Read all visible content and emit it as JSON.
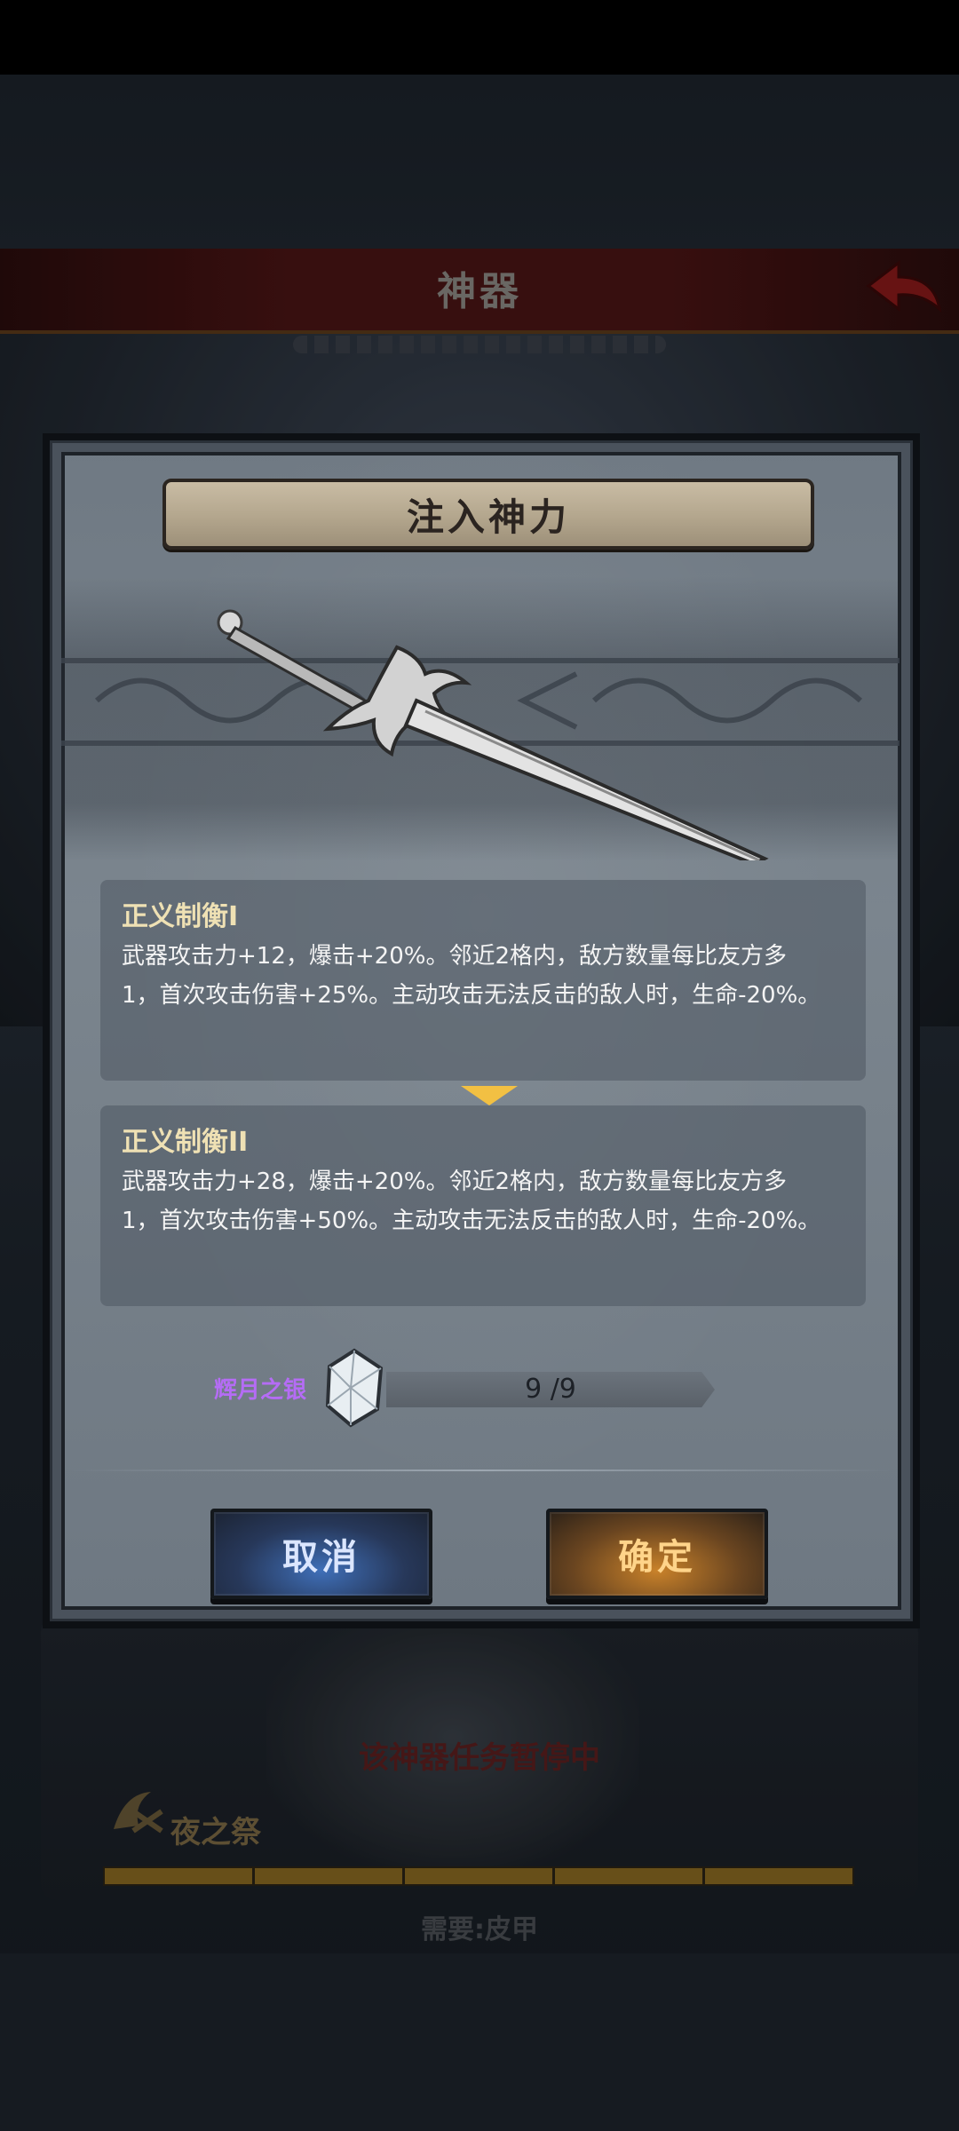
{
  "background": {
    "title": "神器",
    "paused_text": "该神器任务暂停中",
    "night_label": "夜之祭",
    "need_text": "需要:皮甲",
    "progress_segments": 5
  },
  "modal": {
    "title": "注入神力",
    "current": {
      "name": "正义制衡I",
      "line1": "武器攻击力+12，爆击+20%。邻近2格内，敌方数量每比友方多",
      "line2": "1，首次攻击伤害+25%。主动攻击无法反击的敌人时，生命-20%。"
    },
    "next": {
      "name": "正义制衡II",
      "line1": "武器攻击力+28，爆击+20%。邻近2格内，敌方数量每比友方多",
      "line2": "1，首次攻击伤害+50%。主动攻击无法反击的敌人时，生命-20%。"
    },
    "cost": {
      "label": "辉月之银",
      "value": "9 /9",
      "icon": "moon-silver-gem-icon"
    },
    "buttons": {
      "cancel": "取消",
      "confirm": "确定"
    },
    "colors": {
      "skill_name": "#efe1b4",
      "cost_label": "#b56cf5",
      "arrow": "#f2c043",
      "cancel_button": "#3f6fb8",
      "confirm_button": "#c9822a"
    }
  }
}
